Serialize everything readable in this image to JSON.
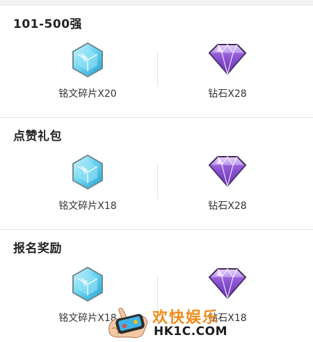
{
  "sections": [
    {
      "title": "101-500强",
      "items": [
        {
          "icon": "inscription-shard-icon",
          "label": "铭文碎片X20"
        },
        {
          "icon": "diamond-icon",
          "label": "钻石X28"
        }
      ]
    },
    {
      "title": "点赞礼包",
      "items": [
        {
          "icon": "inscription-shard-icon",
          "label": "铭文碎片X18"
        },
        {
          "icon": "diamond-icon",
          "label": "钻石X28"
        }
      ]
    },
    {
      "title": "报名奖励",
      "items": [
        {
          "icon": "inscription-shard-icon",
          "label": "铭文碎片X18"
        },
        {
          "icon": "diamond-icon",
          "label": "钻石X18"
        }
      ]
    }
  ],
  "watermark": {
    "brand_cn": "欢快娱乐",
    "site": "HK1C.COM"
  },
  "colors": {
    "shard": "#3ec3e6",
    "diamond": "#8e55cf",
    "brand_orange": "#ee8a1c"
  }
}
